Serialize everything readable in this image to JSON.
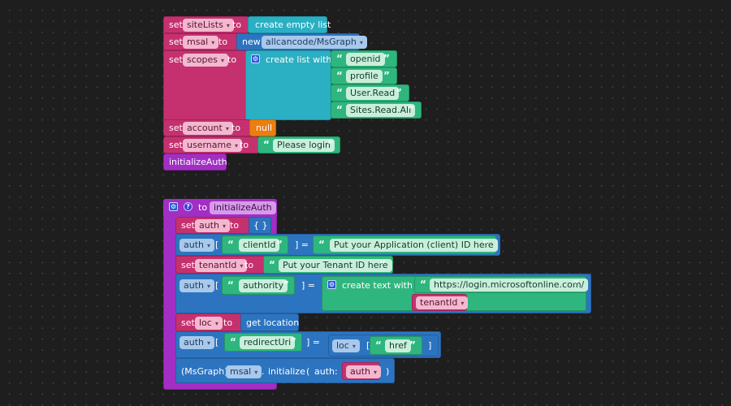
{
  "top_stack": {
    "set_kw": "set",
    "to_kw": "to",
    "row1": {
      "var": "siteLists",
      "value": "create empty list"
    },
    "row2": {
      "var": "msal",
      "new_kw": "new",
      "class": "allcancode/MsGraph"
    },
    "row3": {
      "var": "scopes",
      "list_label": "create list with",
      "items": [
        "openid",
        "profile",
        "User.Read",
        "Sites.Read.All"
      ]
    },
    "row4": {
      "var": "account",
      "value": "null"
    },
    "row5": {
      "var": "username",
      "value": "Please login"
    },
    "call": "initializeAuth"
  },
  "function_def": {
    "to_kw": "to",
    "name": "initializeAuth",
    "gear_icon": "⚙",
    "help_icon": "?",
    "set_auth": {
      "set_kw": "set",
      "var": "auth",
      "to_kw": "to",
      "value": "{ }"
    },
    "assign_client": {
      "obj": "auth",
      "open": "[",
      "key": "clientId",
      "close": "] =",
      "value": "Put your Application (client) ID here"
    },
    "set_tenant": {
      "set_kw": "set",
      "var": "tenantId",
      "to_kw": "to",
      "value": "Put your Tenant ID here"
    },
    "assign_authority": {
      "obj": "auth",
      "open": "[",
      "key": "authority",
      "close": "] =",
      "text_label": "create text with",
      "part1": "https://login.microsoftonline.com/",
      "part2": "tenantId"
    },
    "set_loc": {
      "set_kw": "set",
      "var": "loc",
      "to_kw": "to",
      "value": "get location"
    },
    "assign_redirect": {
      "obj": "auth",
      "open": "[",
      "key": "redirectUri",
      "close": "] =",
      "src": "loc",
      "src_open": "[",
      "src_key": "href",
      "src_close": "]"
    },
    "call": {
      "cast": "(MsGraph)",
      "obj": "msal",
      "dot": ".",
      "method": "initialize",
      "paren_open": "(",
      "arg_label": "auth:",
      "arg": "auth",
      "paren_close": ")"
    }
  },
  "quote_open": "“",
  "quote_close": "”"
}
